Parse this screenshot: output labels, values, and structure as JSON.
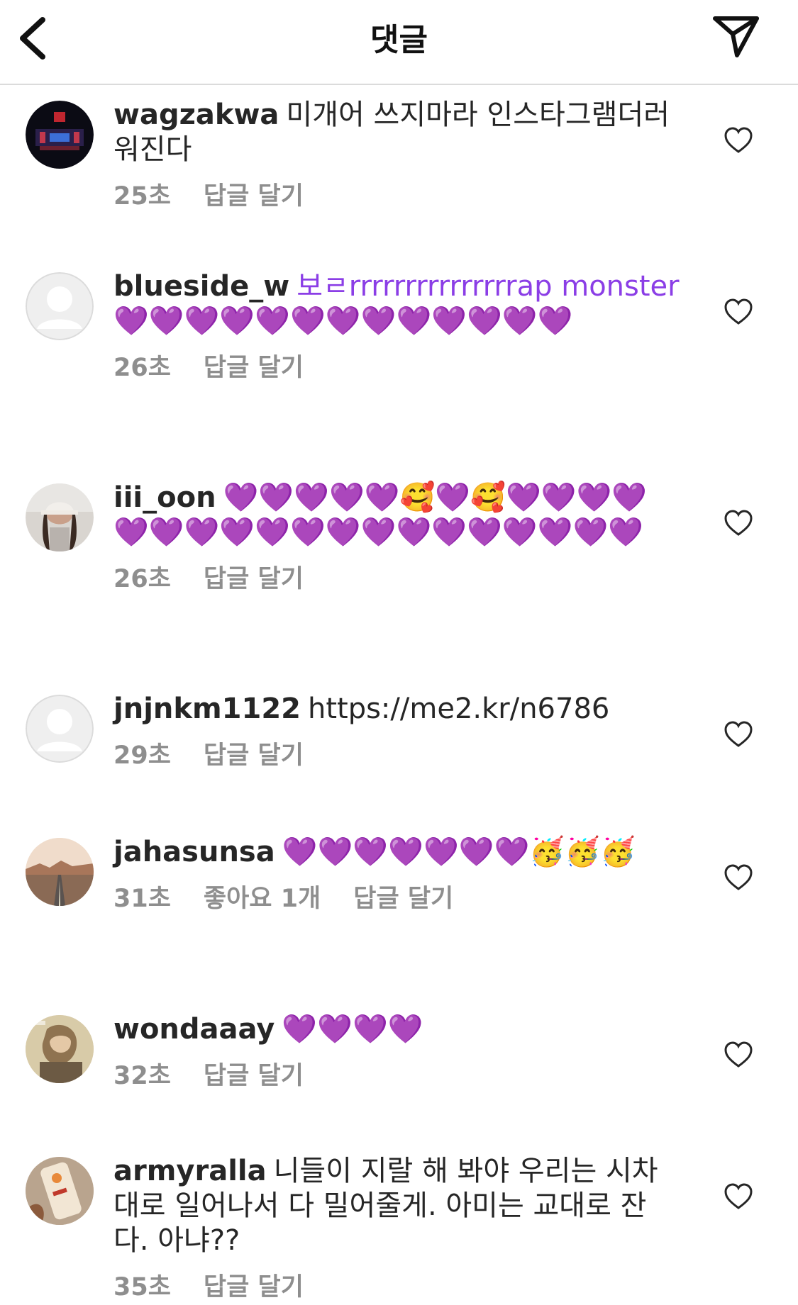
{
  "header": {
    "title": "댓글",
    "back_icon": "chevron-left-icon",
    "send_icon": "paper-plane-icon"
  },
  "colors": {
    "text": "#262626",
    "meta": "#8e8e8e",
    "heart": "#8b3ee6",
    "divider": "#dbdbdb"
  },
  "comments": [
    {
      "username": "wagzakwa",
      "body": "미개어 쓰지마라 인스타그램더러워진다",
      "time": "25초",
      "likes": "",
      "reply": "답글 달기",
      "avatar": "stage-photo"
    },
    {
      "username": "blueside_w",
      "body": "보ㄹrrrrrrrrrrrrrrrap monster💜💜💜💜💜💜💜💜💜💜💜💜💜",
      "time": "26초",
      "likes": "",
      "reply": "답글 달기",
      "avatar": "default"
    },
    {
      "username": "iii_oon",
      "body": "💜💜💜💜💜🥰💜🥰💜💜💜💜💜💜💜💜💜💜💜💜💜💜💜💜💜💜💜",
      "time": "26초",
      "likes": "",
      "reply": "답글 달기",
      "avatar": "girl-cap-photo"
    },
    {
      "username": "jnjnkm1122",
      "body": "https://me2.kr/n6786",
      "time": "29초",
      "likes": "",
      "reply": "답글 달기",
      "avatar": "default"
    },
    {
      "username": "jahasunsa",
      "body": "💜💜💜💜💜💜💜🥳🥳🥳",
      "time": "31초",
      "likes": "좋아요 1개",
      "reply": "답글 달기",
      "avatar": "desert-road-photo"
    },
    {
      "username": "wondaaay",
      "body": "💜💜💜💜",
      "time": "32초",
      "likes": "",
      "reply": "답글 달기",
      "avatar": "vintage-photo"
    },
    {
      "username": "armyralla",
      "body": "니들이 지랄 해 봐야 우리는 시차대로 일어나서 다 밀어줄게. 아미는 교대로 잔다. 아냐??",
      "time": "35초",
      "likes": "",
      "reply": "답글 달기",
      "avatar": "phone-case-photo"
    }
  ]
}
